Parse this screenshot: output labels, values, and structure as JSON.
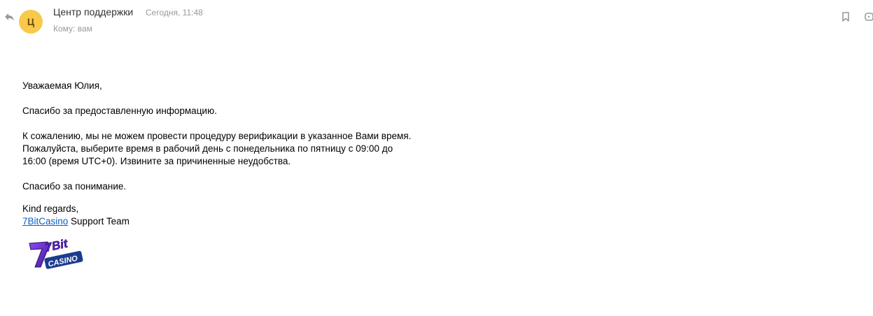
{
  "header": {
    "avatar_letter": "Ц",
    "avatar_color": "#f8c94a",
    "sender_name": "Центр поддержки",
    "timestamp": "Сегодня, 11:48",
    "recipient_label": "Кому:",
    "recipient": "вам"
  },
  "body": {
    "greeting": "Уважаемая Юлия,",
    "thanks_info": "Спасибо за предоставленную информацию.",
    "para_line1": "К сожалению, мы не можем провести процедуру верификации в указанное Вами время.",
    "para_line2": "Пожалуйста, выберите время в рабочий день с понедельника по пятницу с 09:00 до",
    "para_line3": "16:00 (время UTC+0). Извините за причиненные неудобства.",
    "thanks_understanding": "Спасибо за понимание.",
    "regards": "Kind regards,",
    "signature_link": "7BitCasino",
    "signature_suffix": " Support Team"
  },
  "logo": {
    "text_top": "7Bit",
    "text_bottom": "CASINO"
  },
  "colors": {
    "link": "#0b5fc4",
    "muted": "#999999",
    "logo_purple": "#6a2bd8",
    "logo_blue": "#1a3d8f"
  },
  "icons": [
    "reply-icon",
    "bookmark-icon",
    "more-icon"
  ]
}
